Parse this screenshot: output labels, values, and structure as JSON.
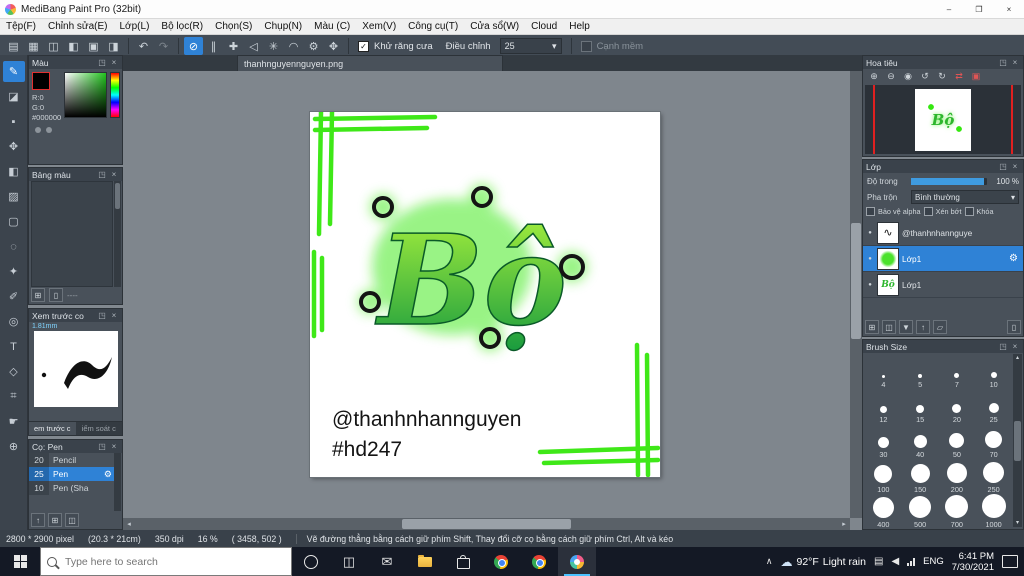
{
  "titlebar": {
    "title": "MediBang Paint Pro (32bit)"
  },
  "menubar": {
    "items": [
      "Tệp(F)",
      "Chỉnh sửa(E)",
      "Lớp(L)",
      "Bộ lọc(R)",
      "Chọn(S)",
      "Chụp(N)",
      "Màu (C)",
      "Xem(V)",
      "Công cụ(T)",
      "Cửa sổ(W)",
      "Cloud",
      "Help"
    ]
  },
  "toolbar": {
    "antialias_label": "Khử răng cưa",
    "adjust_label": "Điều chỉnh",
    "adjust_value": "25",
    "soft_edge_label": "Cạnh mềm"
  },
  "document": {
    "tab_title": "thanhnguyennguyen.png"
  },
  "artwork": {
    "lettering": "Bộ",
    "handle": "@thanhnhannguyen",
    "hashtag": "#hd247",
    "accent_green": "#35e810"
  },
  "panels": {
    "color": {
      "title": "Màu",
      "r": "R:0",
      "g": "G:0",
      "hex": "#000000"
    },
    "palette": {
      "title": "Bảng màu",
      "footer": "----"
    },
    "preview": {
      "title": "Xem trước co",
      "brush_width": "1.81mm",
      "tab_preview": "em trước c",
      "tab_control": "iểm soát c"
    },
    "brushes": {
      "title": "Cọ: Pen",
      "items": [
        {
          "size": "20",
          "name": "Pencil"
        },
        {
          "size": "25",
          "name": "Pen"
        },
        {
          "size": "10",
          "name": "Pen (Sha"
        }
      ]
    },
    "navigator": {
      "title": "Hoa tiêu"
    },
    "layers": {
      "title": "Lớp",
      "opacity_label": "Độ trong",
      "opacity_value": "100 %",
      "blend_label": "Pha trộn",
      "blend_value": "Bình thường",
      "protect_alpha": "Bảo vệ alpha",
      "clipping": "Xén bớt",
      "lock": "Khóa",
      "items": [
        {
          "name": "@thanhnhannguye"
        },
        {
          "name": "Lớp1"
        },
        {
          "name": "Lớp1"
        }
      ]
    },
    "brush_size": {
      "title": "Brush Size",
      "sizes": [
        "4",
        "5",
        "7",
        "10",
        "12",
        "15",
        "20",
        "25",
        "30",
        "40",
        "50",
        "70",
        "100",
        "150",
        "200",
        "250",
        "400",
        "500",
        "700",
        "1000"
      ]
    }
  },
  "statusbar": {
    "dimensions": "2800 * 2900 pixel",
    "size_cm": "(20.3 * 21cm)",
    "dpi": "350 dpi",
    "zoom": "16 %",
    "coords": "( 3458, 502 )",
    "hint": "Vẽ đường thẳng bằng cách giữ phím Shift, Thay đổi cỡ cọ bằng cách giữ phím Ctrl, Alt và kéo"
  },
  "taskbar": {
    "search_placeholder": "Type here to search",
    "weather_temp": "92°F",
    "weather_desc": "Light rain",
    "language": "ENG",
    "time": "6:41 PM",
    "date": "7/30/2021"
  },
  "icons": {
    "close": "×",
    "popout": "◳",
    "minimize": "–",
    "maximize": "❐",
    "new_file": "▤",
    "open": "▦",
    "save": "◫",
    "chat": "◧",
    "note": "▣",
    "panel": "◨",
    "grid": "▦",
    "undo": "↶",
    "redo": "↷",
    "snap_off": "⊘",
    "snap_parallel": "∥",
    "snap_cross": "✚",
    "snap_vanish": "◁",
    "snap_radial": "✳",
    "snap_curve": "◠",
    "snap_move": "✥",
    "gear": "⚙",
    "dropdown": "▾",
    "check": "✓",
    "brush": "✎",
    "eraser": "◪",
    "dot": "▪",
    "move": "✥",
    "fill": "◧",
    "gradient": "▨",
    "select": "▢",
    "lasso": "◌",
    "wand": "✦",
    "select_pen": "✐",
    "eyedropper": "◎",
    "text": "T",
    "shape": "◇",
    "divide": "⌗",
    "hand": "☛",
    "zoom_tool": "⊕",
    "zoom_in": "⊕",
    "zoom_out": "⊖",
    "zoom_reset": "◉",
    "rotate_left": "↺",
    "rotate_right": "↻",
    "flip": "⇄",
    "fit": "▣",
    "eye": "●",
    "add": "⊞",
    "duplicate": "◫",
    "merge": "▼",
    "folder": "▱",
    "trash": "▯",
    "up_arrow": "↑",
    "left": "◂",
    "right": "▸",
    "up": "▴",
    "down": "▾",
    "stroke": "∿",
    "chevron_up": "∧",
    "cloud": "☁",
    "sun": "☀",
    "mail": "✉",
    "volume": "◀",
    "keyboard": "▤"
  }
}
